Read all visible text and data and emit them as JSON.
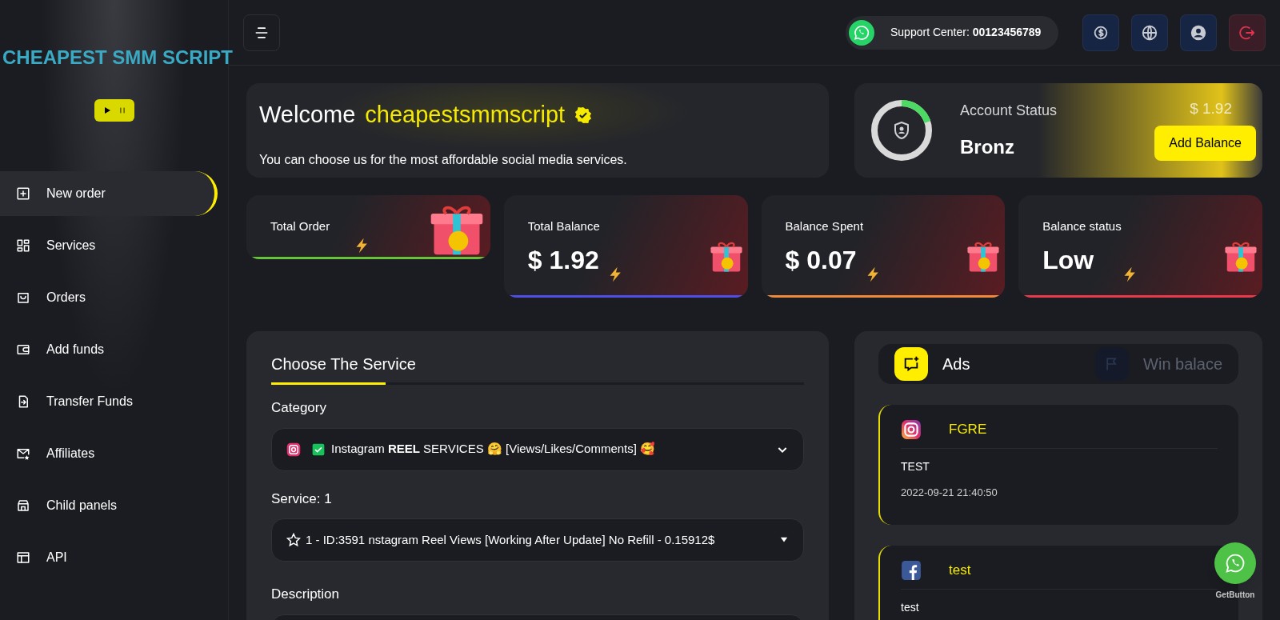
{
  "sidebar": {
    "logo": "CHEAPEST SMM SCRIPT",
    "items": [
      {
        "label": "New order",
        "selected": true
      },
      {
        "label": "Services",
        "selected": false
      },
      {
        "label": "Orders",
        "selected": false
      },
      {
        "label": "Add funds",
        "selected": false
      },
      {
        "label": "Transfer Funds",
        "selected": false
      },
      {
        "label": "Affiliates",
        "selected": false
      },
      {
        "label": "Child panels",
        "selected": false
      },
      {
        "label": "API",
        "selected": false
      }
    ]
  },
  "topbar": {
    "support_label": "Support Center:",
    "support_number": "00123456789"
  },
  "welcome": {
    "greeting": "Welcome",
    "username": "cheapestsmmscript",
    "subtitle": "You can choose us for the most affordable social media services."
  },
  "account": {
    "label": "Account Status",
    "status": "Bronz",
    "level": 0.2,
    "balance": "$ 1.92",
    "button": "Add Balance"
  },
  "stats": [
    {
      "label": "Total Order",
      "color": "#65c23a"
    },
    {
      "label": "Total Balance",
      "value": "$ 1.92",
      "color": "#4f4fe8"
    },
    {
      "label": "Balance Spent",
      "value": "$ 0.07",
      "color": "#f08a3a"
    },
    {
      "label": "Balance status",
      "value": "Low",
      "color": "#e83a4a"
    }
  ],
  "form": {
    "title": "Choose The Service",
    "category_label": "Category",
    "category": "Instagram **REEL** SERVICES 🤗 [Views/Likes/Comments] 🥰",
    "service_label": "Service: 1",
    "service": "1 - ID:3591 nstagram Reel Views [Working After Update] No Refill - 0.15912$",
    "description_label": "Description"
  },
  "ads_panel": {
    "tabs": [
      {
        "label": "Ads",
        "selected": true
      },
      {
        "label": "Win balace",
        "selected": false
      }
    ],
    "ads": [
      {
        "kind": "instagram",
        "title": "FGRE",
        "text": "TEST",
        "date": "2022-09-21 21:40:50"
      },
      {
        "kind": "facebook",
        "title": "test",
        "text": "test"
      }
    ]
  },
  "chat_widget": {
    "label": "GetButton"
  }
}
